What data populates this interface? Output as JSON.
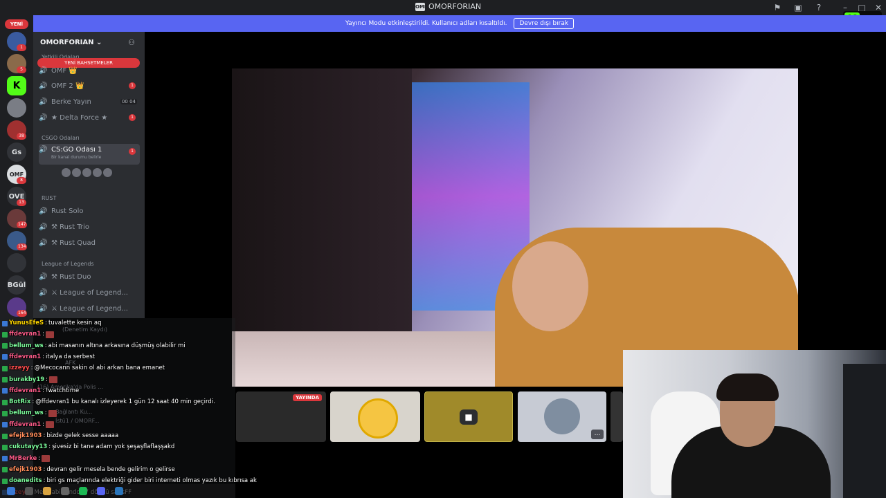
{
  "window": {
    "title": "OMORFORIAN",
    "logo_text": "OMF"
  },
  "titlebar_icons": [
    "inbox-icon",
    "screen-icon",
    "help-icon",
    "minimize-icon",
    "maximize-icon",
    "close-icon"
  ],
  "kick_badge": {
    "letter": "K",
    "viewers": "64",
    "color": "#53fc18"
  },
  "banner": {
    "text": "Yayıncı Modu etkinleştirildi. Kullanıcı adları kısaltıldı.",
    "button": "Devre dışı bırak",
    "color": "#5865f2"
  },
  "guilds": {
    "new_label": "YENİ",
    "items": [
      {
        "text": "",
        "badge": "1",
        "color": "#3a5ba0"
      },
      {
        "text": "",
        "badge": "5",
        "color": "#8a6a4a"
      },
      {
        "text": "K",
        "badge": "",
        "color": "#53fc18"
      },
      {
        "text": "",
        "badge": "",
        "color": "#7a7d85"
      },
      {
        "text": "",
        "badge": "38",
        "color": "#a03030"
      },
      {
        "text": "Gs",
        "badge": "",
        "color": "#313338"
      },
      {
        "text": "OMF",
        "badge": "8",
        "color": "#dbdee1"
      },
      {
        "text": "OVE",
        "badge": "13",
        "color": "#313338"
      },
      {
        "text": "",
        "badge": "147",
        "color": "#6a3a3a"
      },
      {
        "text": "",
        "badge": "134",
        "color": "#3a5a8a"
      },
      {
        "text": "",
        "badge": "",
        "color": "#313338"
      },
      {
        "text": "BGül",
        "badge": "",
        "color": "#313338"
      },
      {
        "text": "",
        "badge": "164",
        "color": "#5a3a8a"
      }
    ]
  },
  "server": {
    "name": "OMORFORIAN",
    "new_mentions": "YENİ BAHSETMELER",
    "categories": {
      "yetkili": "Yetkili Odaları",
      "csgo": "CSGO Odaları",
      "rust": "RUST",
      "lol": "League of Legends"
    },
    "channels": [
      {
        "name": "OMF 👑",
        "badge": "",
        "limit": ""
      },
      {
        "name": "OMF 2 👑",
        "badge": "1",
        "limit": ""
      },
      {
        "name": "Berke Yayın",
        "badge": "",
        "limit": "00 04"
      },
      {
        "name": "★ Delta Force ★",
        "badge": "1",
        "limit": ""
      },
      {
        "name": "CS:GO Odası 1",
        "badge": "1",
        "limit": "",
        "status": "Bir kanal durumu belirle"
      },
      {
        "name": "Rust Solo",
        "badge": "",
        "limit": ""
      },
      {
        "name": "⚒ Rust Trio",
        "badge": "",
        "limit": ""
      },
      {
        "name": "⚒ Rust Quad",
        "badge": "",
        "limit": ""
      },
      {
        "name": "⚒ Rust Duo",
        "badge": "",
        "limit": ""
      },
      {
        "name": "⚔ League of Legend...",
        "badge": "",
        "limit": ""
      },
      {
        "name": "⚔ League of Legend...",
        "badge": "",
        "limit": ""
      }
    ]
  },
  "stream": {
    "live_label": "YAYINDA"
  },
  "chat": [
    {
      "user": "YunusEfeS",
      "text": "tuvalette kesin aq",
      "color": "#ffd700"
    },
    {
      "user": "ffdevran1",
      "text": "",
      "color": "#ff5c8a",
      "emote": true
    },
    {
      "user": "bellum_ws",
      "text": "abi masanın altına arkasına düşmüş olabilir mi",
      "color": "#7cfc9c"
    },
    {
      "user": "ffdevran1",
      "text": "italya da serbest",
      "color": "#ff5c8a"
    },
    {
      "user": "izzeyy",
      "text": "@Mecocann sakin ol abi arkan bana emanet",
      "color": "#ff4d4d"
    },
    {
      "user": "burakby19",
      "text": "",
      "color": "#7cfc9c",
      "emote": true
    },
    {
      "user": "ffdevran1",
      "text": "!watchtime",
      "color": "#ff5c8a"
    },
    {
      "user": "BotRix",
      "text": "@ffdevran1 bu kanalı izleyerek 1 gün 12 saat 40 min geçirdi.",
      "color": "#7cfc9c"
    },
    {
      "user": "bellum_ws",
      "text": "",
      "color": "#7cfc9c",
      "emote": true
    },
    {
      "user": "ffdevran1",
      "text": "",
      "color": "#ff5c8a",
      "emote": true
    },
    {
      "user": "efejk1903",
      "text": "bizde gelek sesse aaaaa",
      "color": "#ff8c5a"
    },
    {
      "user": "cukutayy13",
      "text": "şivesiz bi tane adam yok şeşaşflaflaşşakd",
      "color": "#7cfc9c"
    },
    {
      "user": "MrBerke",
      "text": "",
      "color": "#ff5c8a",
      "emote": true
    },
    {
      "user": "efejk1903",
      "text": "devran gelir mesela bende gelirim o gelirse",
      "color": "#ff8c5a"
    },
    {
      "user": "doanedits",
      "text": "biri gs maçlarında elektriği gider biri interneti olmas yazık bu kıbrısa ak",
      "color": "#7cfc9c"
    },
    {
      "user": "izzeyy",
      "text": "Meco abi windos 7 döndü saffsFF",
      "color": "#ff4d4d"
    }
  ],
  "ghost_text": {
    "audit": "(Denetim Kaydı)",
    "afk": "AFK",
    "polis": "(16) Amerika'da Polis ...",
    "connection": "Bağlantı Ku...",
    "sub": "İstü1 / OMORF..."
  }
}
